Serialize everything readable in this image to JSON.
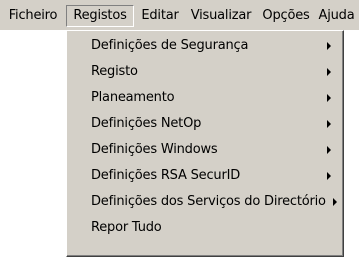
{
  "menubar": {
    "items": [
      {
        "label": "Ficheiro"
      },
      {
        "label": "Registos"
      },
      {
        "label": "Editar"
      },
      {
        "label": "Visualizar"
      },
      {
        "label": "Opções"
      },
      {
        "label": "Ajuda"
      }
    ],
    "open_menu": "Registos"
  },
  "registos_menu": {
    "items": [
      {
        "label": "Definições de Segurança",
        "submenu_icon": "submenu-arrow-icon"
      },
      {
        "label": "Registo",
        "submenu_icon": "submenu-arrow-icon"
      },
      {
        "label": "Planeamento",
        "submenu_icon": "submenu-arrow-icon"
      },
      {
        "label": "Definições NetOp",
        "submenu_icon": "submenu-arrow-icon"
      },
      {
        "label": "Definições Windows",
        "submenu_icon": "submenu-arrow-icon"
      },
      {
        "label": "Definições RSA SecurID",
        "submenu_icon": "submenu-arrow-icon"
      },
      {
        "label": "Definições dos Serviços do Directório",
        "submenu_icon": "submenu-arrow-icon"
      },
      {
        "label": "Repor Tudo"
      }
    ]
  },
  "colors": {
    "menu_background": "#d4d0c8",
    "page_background": "#ffffff",
    "text": "#000000"
  }
}
